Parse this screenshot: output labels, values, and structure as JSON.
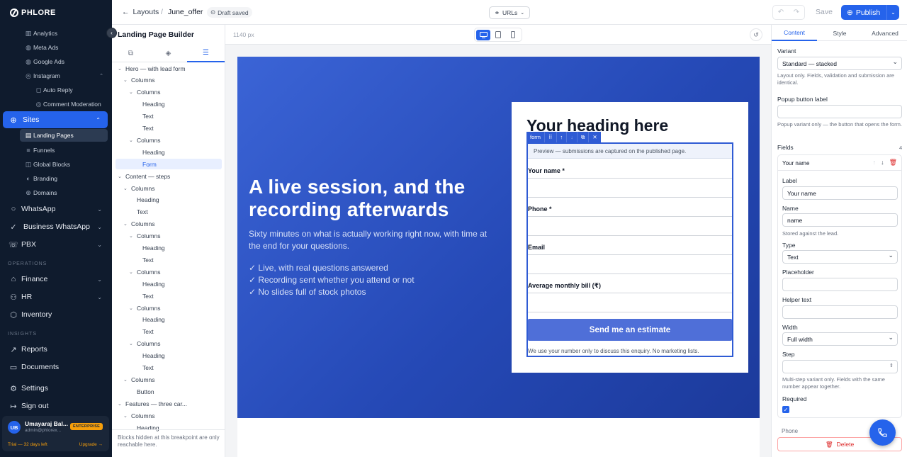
{
  "brand": {
    "name": "PHLORE",
    "accent": "#2563eb",
    "nav_bg": "#0f1b2d"
  },
  "nav": {
    "sub_top": [
      {
        "label": "Analytics",
        "icon": "chart-icon"
      },
      {
        "label": "Meta Ads",
        "icon": "meta-icon"
      },
      {
        "label": "Google Ads",
        "icon": "google-icon"
      },
      {
        "label": "Instagram",
        "icon": "instagram-icon"
      }
    ],
    "instagram_children": [
      "Auto Reply",
      "Comment Moderation"
    ],
    "sites": {
      "label": "Sites",
      "children": [
        "Landing Pages",
        "Funnels",
        "Global Blocks",
        "Branding",
        "Domains"
      ]
    },
    "main_1": [
      "WhatsApp",
      "Business WhatsApp",
      "PBX"
    ],
    "section_operations": "OPERATIONS",
    "main_2": [
      "Finance",
      "HR",
      "Inventory"
    ],
    "section_insights": "INSIGHTS",
    "main_3": [
      "Reports",
      "Documents"
    ],
    "settings": "Settings",
    "signout": "Sign out"
  },
  "user": {
    "initials": "UB",
    "name": "Umayaraj Bal...",
    "email": "admin@phlorex...",
    "plan": "ENTERPRISE",
    "trial": "Trial — 32 days left",
    "upgrade": "Upgrade →"
  },
  "topbar": {
    "back": "Layouts",
    "separator": "/",
    "page": "June_offer",
    "status": "Draft saved",
    "urls": "URLs",
    "save": "Save",
    "publish": "Publish"
  },
  "builder": {
    "title": "Landing Page Builder",
    "tree": [
      {
        "label": "Hero — with lead form",
        "depth": 0,
        "tw": "⌄"
      },
      {
        "label": "Columns",
        "depth": 1,
        "tw": "⌄"
      },
      {
        "label": "Columns",
        "depth": 2,
        "tw": "⌄"
      },
      {
        "label": "Heading",
        "depth": 3,
        "tw": ""
      },
      {
        "label": "Text",
        "depth": 3,
        "tw": ""
      },
      {
        "label": "Text",
        "depth": 3,
        "tw": ""
      },
      {
        "label": "Columns",
        "depth": 2,
        "tw": "⌄"
      },
      {
        "label": "Heading",
        "depth": 3,
        "tw": ""
      },
      {
        "label": "Form",
        "depth": 3,
        "tw": "",
        "selected": true
      },
      {
        "label": "Content — steps",
        "depth": 0,
        "tw": "⌄"
      },
      {
        "label": "Columns",
        "depth": 1,
        "tw": "⌄"
      },
      {
        "label": "Heading",
        "depth": 2,
        "tw": ""
      },
      {
        "label": "Text",
        "depth": 2,
        "tw": ""
      },
      {
        "label": "Columns",
        "depth": 1,
        "tw": "⌄"
      },
      {
        "label": "Columns",
        "depth": 2,
        "tw": "⌄"
      },
      {
        "label": "Heading",
        "depth": 3,
        "tw": ""
      },
      {
        "label": "Text",
        "depth": 3,
        "tw": ""
      },
      {
        "label": "Columns",
        "depth": 2,
        "tw": "⌄"
      },
      {
        "label": "Heading",
        "depth": 3,
        "tw": ""
      },
      {
        "label": "Text",
        "depth": 3,
        "tw": ""
      },
      {
        "label": "Columns",
        "depth": 2,
        "tw": "⌄"
      },
      {
        "label": "Heading",
        "depth": 3,
        "tw": ""
      },
      {
        "label": "Text",
        "depth": 3,
        "tw": ""
      },
      {
        "label": "Columns",
        "depth": 2,
        "tw": "⌄"
      },
      {
        "label": "Heading",
        "depth": 3,
        "tw": ""
      },
      {
        "label": "Text",
        "depth": 3,
        "tw": ""
      },
      {
        "label": "Columns",
        "depth": 1,
        "tw": "⌄"
      },
      {
        "label": "Button",
        "depth": 2,
        "tw": ""
      },
      {
        "label": "Features — three car...",
        "depth": 0,
        "tw": "⌄"
      },
      {
        "label": "Columns",
        "depth": 1,
        "tw": "⌄"
      },
      {
        "label": "Heading",
        "depth": 2,
        "tw": ""
      }
    ],
    "hint": "Blocks hidden at this breakpoint are only reachable here."
  },
  "canvas": {
    "width_label": "1140 px",
    "hero": {
      "heading": "A live session, and the recording afterwards",
      "subtext": "Sixty minutes on what is actually working right now, with time at the end for your questions.",
      "bullets": [
        "✓ Live, with real questions answered",
        "✓ Recording sent whether you attend or not",
        "✓ No slides full of stock photos"
      ]
    },
    "form_card": {
      "heading": "Your heading here",
      "block_tag": "form",
      "preview_note": "Preview — submissions are captured on the published page.",
      "fields": [
        "Your name *",
        "Phone *",
        "Email",
        "Average monthly bill (₹)"
      ],
      "submit": "Send me an estimate",
      "footnote": "We use your number only to discuss this enquiry. No marketing lists."
    }
  },
  "inspector": {
    "tabs": [
      "Content",
      "Style",
      "Advanced"
    ],
    "variant_label": "Variant",
    "variant_value": "Standard — stacked",
    "variant_help": "Layout only. Fields, validation and submission are identical.",
    "popup_label": "Popup button label",
    "popup_value": "",
    "popup_help": "Popup variant only — the button that opens the form.",
    "fields_label": "Fields",
    "fields_count": "4",
    "field": {
      "title": "Your name",
      "label_label": "Label",
      "label_value": "Your name",
      "name_label": "Name",
      "name_value": "name",
      "name_help": "Stored against the lead.",
      "type_label": "Type",
      "type_value": "Text",
      "placeholder_label": "Placeholder",
      "helper_label": "Helper text",
      "width_label": "Width",
      "width_value": "Full width",
      "step_label": "Step",
      "step_help": "Multi-step variant only. Fields with the same number appear together.",
      "required_label": "Required"
    },
    "next_field": "Phone",
    "delete": "Delete"
  }
}
